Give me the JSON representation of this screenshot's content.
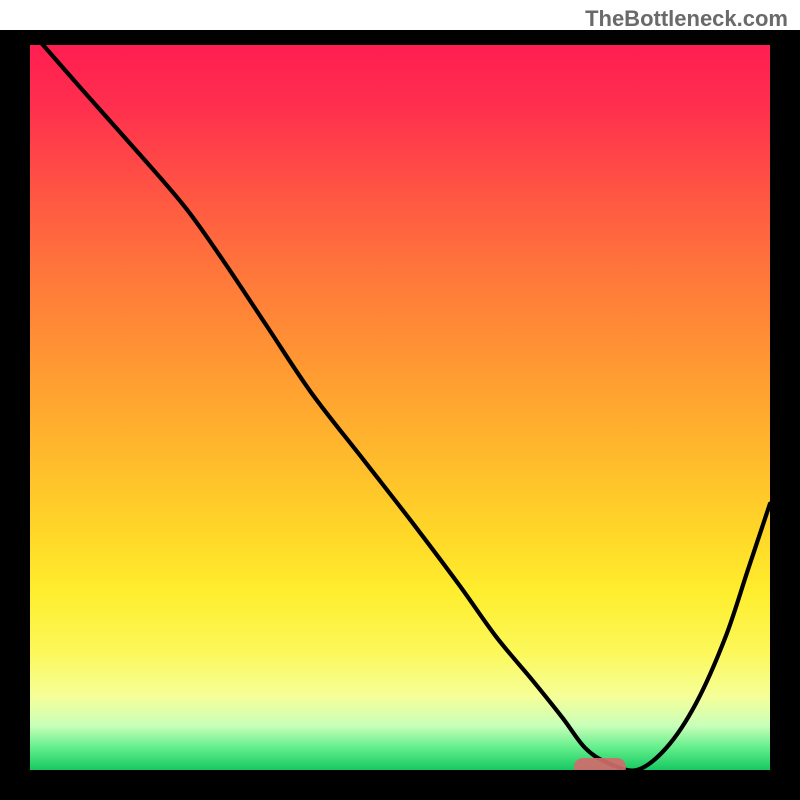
{
  "watermark": "TheBottleneck.com",
  "colors": {
    "curve": "#000000",
    "frame": "#000000",
    "marker": "#d16b6b",
    "gradient_top": "#ff1a52",
    "gradient_bottom": "#16c862"
  },
  "chart_data": {
    "type": "line",
    "title": "",
    "xlabel": "",
    "ylabel": "",
    "xlim": [
      0,
      100
    ],
    "ylim": [
      0,
      100
    ],
    "grid": false,
    "legend": false,
    "x": [
      0,
      7,
      15,
      21,
      26,
      32,
      38,
      45,
      52,
      58,
      63,
      68,
      72,
      75,
      78,
      82,
      86,
      90,
      94,
      97,
      100
    ],
    "values": [
      100,
      92,
      83,
      76,
      69,
      60,
      51,
      42,
      33,
      25,
      18,
      12,
      7,
      3,
      1,
      0,
      3,
      9,
      18,
      27,
      36
    ],
    "marker": {
      "x_center": 77,
      "y": 0,
      "width": 7
    },
    "annotations": []
  }
}
